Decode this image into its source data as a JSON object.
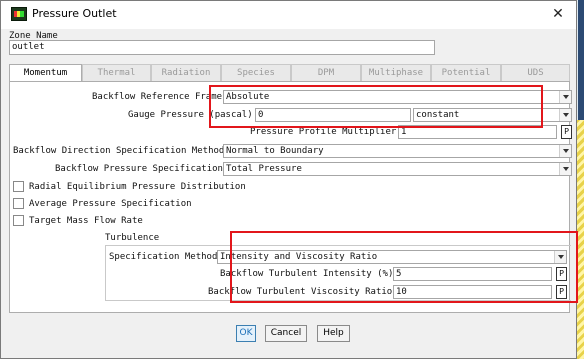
{
  "window": {
    "title": "Pressure Outlet",
    "close_glyph": "✕"
  },
  "zone": {
    "label": "Zone Name",
    "value": "outlet"
  },
  "tabs": [
    {
      "label": "Momentum",
      "active": true
    },
    {
      "label": "Thermal",
      "active": false
    },
    {
      "label": "Radiation",
      "active": false
    },
    {
      "label": "Species",
      "active": false
    },
    {
      "label": "DPM",
      "active": false
    },
    {
      "label": "Multiphase",
      "active": false
    },
    {
      "label": "Potential",
      "active": false
    },
    {
      "label": "UDS",
      "active": false
    }
  ],
  "momentum": {
    "backflow_ref_frame": {
      "label": "Backflow Reference Frame",
      "value": "Absolute"
    },
    "gauge_pressure": {
      "label": "Gauge Pressure (pascal)",
      "value": "0",
      "method": "constant"
    },
    "pressure_profile_multiplier": {
      "label": "Pressure Profile Multiplier",
      "value": "1",
      "p_button": "P"
    },
    "backflow_direction": {
      "label": "Backflow Direction Specification Method",
      "value": "Normal to Boundary"
    },
    "backflow_pressure": {
      "label": "Backflow Pressure Specification",
      "value": "Total Pressure"
    },
    "checkboxes": [
      {
        "label": "Radial Equilibrium Pressure Distribution",
        "checked": false
      },
      {
        "label": "Average Pressure Specification",
        "checked": false
      },
      {
        "label": "Target Mass Flow Rate",
        "checked": false
      }
    ],
    "turbulence": {
      "group_label": "Turbulence",
      "spec_method": {
        "label": "Specification Method",
        "value": "Intensity and Viscosity Ratio"
      },
      "intensity": {
        "label": "Backflow Turbulent Intensity (%)",
        "value": "5",
        "p_button": "P"
      },
      "viscosity_ratio": {
        "label": "Backflow Turbulent Viscosity Ratio",
        "value": "10",
        "p_button": "P"
      }
    }
  },
  "buttons": {
    "ok": "OK",
    "cancel": "Cancel",
    "help": "Help"
  },
  "colors": {
    "highlight": "#e2161b",
    "ok_text": "#1b6fb8"
  },
  "icons": [
    "fluent-app-icon",
    "close-icon",
    "chevron-down-icon"
  ]
}
